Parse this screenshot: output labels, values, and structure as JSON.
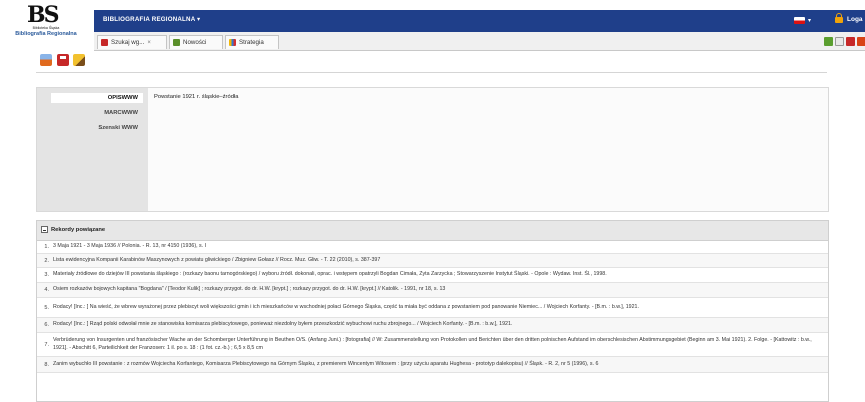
{
  "logo": {
    "mark": "BS",
    "line1": "Biblioteka Śląska",
    "line2": "Bibliografia Regionalna"
  },
  "header": {
    "menu_title": "BIBLIOGRAFIA REGIONALNA ▾",
    "language_caret": "▾",
    "login_label": "Loga"
  },
  "tabs": [
    {
      "label": "Szukaj wg...",
      "close": "×"
    },
    {
      "label": "Nowości"
    },
    {
      "label": "Strategia"
    }
  ],
  "record": {
    "format_tabs": [
      "OPISWWW",
      "MARCWWW",
      "Szenski WWW"
    ],
    "active_tab": "OPISWWW",
    "content": "Powstanie 1921 r. śląskie–źródła"
  },
  "related": {
    "title": "Rekordy powiązane",
    "rows": [
      {
        "n": "1.",
        "text": "3 Maja 1921 - 3 Maja 1936 // Polonia. - R. 13, nr 4150 (1936), s. I"
      },
      {
        "n": "2.",
        "text": "Lista ewidencyjna Kompanii Karabinów Maszynowych z powiatu gliwickiego / Zbigniew Gołasz // Rocz. Muz. Gliw. - T. 22 (2010), s. 387-397"
      },
      {
        "n": "3.",
        "text": "Materiały źródłowe do dziejów III powstania śląskiego : (rozkazy baonu tarnogórskiego) / wyboru źródł. dokonali, oprac. i wstępem opatrzyli Bogdan Cimała, Zyta Zarzycka ; Stowarzyszenie Instytut Śląski. - Opole : Wydaw. Inst. Śl., 1998."
      },
      {
        "n": "4.",
        "text": "Osiem rozkazów bojowych kapitana \"Bogdana\" / [Teodor Kulik] ; rozkazy przygot. do dr. H.W. [krypt.] ; rozkazy przygot. do dr. H.W. [krypt.] // Katolik. - 1991, nr 18, s. 13"
      },
      {
        "n": "5.",
        "text": "Rodacy! [Inc.: ] Na wieść, że wbrew wyrażonej przez plebiscyt woli większości gmin i ich mieszkańców w wschodniej połaci Górnego Śląska, część ta miała być oddana z powstaniem pod panowanie Niemiec... / Wojciech Korfanty. - [B.m. : b.w.], 1921."
      },
      {
        "n": "6.",
        "text": "Rodacy! [Inc.: ] Rząd polski odwołał mnie ze stanowiska komisarza plebiscytowego, ponieważ niezdolny byłem przeszkodzić wybuchowi ruchu zbrojnego... / Wojciech Korfanty. - [B.m. : b.w.], 1921."
      },
      {
        "n": "7.",
        "text": "Verbrüderung von Insurgenten und französischer Wache an der Schomberger Unterführung in Beuthen O/S. (Anfang Juni.) : [fotografia] // W: Zusammenstellung von Protokollen und Berichten über den dritten polnischen Aufstand im oberschlesischen Abstimmungsgebiet (Beginn am 3. Mai 1921). 2. Folge. - [Kattowitz : b.w., 1921]. - Abschitt 6, Parteilichkeit der Franzosen: 1 il. po s. 18 : (1 fot. cz.-b.) ; 6,5 x 8,5 cm"
      },
      {
        "n": "8.",
        "text": "Zanim wybuchło III powstanie : z rozmów Wojciecha Korfantego, Komisarza Plebiscytowego na Górnym Śląsku, z premierem Wincentym Witosem : (przy użyciu aparatu Hughesa - prototyp dalekopisu) // Śląsk. - R. 2, nr 5 (1996), s. 6"
      }
    ]
  },
  "colors": {
    "header_blue": "#1f3f8a",
    "panel_gray": "#e4e4e4",
    "login_orange": "#f0a30a"
  },
  "icons": [
    "print-icon",
    "save-icon",
    "bookmark-icon",
    "flag-icon",
    "lock-icon",
    "search-icon",
    "news-icon",
    "strategy-icon"
  ]
}
